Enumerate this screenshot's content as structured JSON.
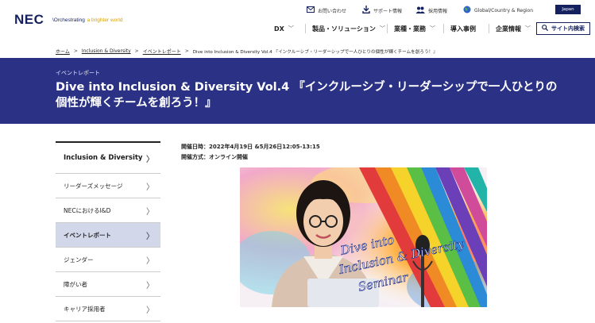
{
  "header": {
    "logo": "NEC",
    "tagline_prefix": "\\Orchestrating",
    "tagline_accent": " a brighter world",
    "utility": [
      {
        "icon": "mail-icon",
        "label": "お問い合わせ"
      },
      {
        "icon": "download-icon",
        "label": "サポート情報"
      },
      {
        "icon": "people-icon",
        "label": "採用情報"
      },
      {
        "icon": "globe-icon",
        "label": "Global/Country & Region"
      }
    ],
    "language": "Japan",
    "gnav": [
      {
        "label": "DX"
      },
      {
        "label": "製品・ソリューション"
      },
      {
        "label": "業種・業務"
      },
      {
        "label": "導入事例"
      },
      {
        "label": "企業情報"
      }
    ],
    "search_label": "サイト内検索"
  },
  "breadcrumb": [
    "ホーム",
    "Inclusion & Diversity",
    "イベントレポート",
    "Dive into Inclusion & Diversity Vol.4 『インクルーシブ・リーダーシップで一人ひとりの個性が輝くチームを創ろう！』"
  ],
  "hero": {
    "eyebrow": "イベントレポート",
    "title": "Dive into Inclusion & Diversity Vol.4 『インクルーシブ・リーダーシップで一人ひとりの個性が輝くチームを創ろう！』"
  },
  "sidebar": {
    "heading": "Inclusion & Diversity",
    "items": [
      {
        "label": "リーダーズメッセージ",
        "active": false
      },
      {
        "label": "NECにおけるI&D",
        "active": false
      },
      {
        "label": "イベントレポート",
        "active": true
      },
      {
        "label": "ジェンダー",
        "active": false
      },
      {
        "label": "障がい者",
        "active": false
      },
      {
        "label": "キャリア採用者",
        "active": false
      }
    ]
  },
  "event": {
    "date": "開催日時：2022年4月19日 &5月26日12:05-13:15",
    "format": "開催方式：オンライン開催"
  },
  "photo": {
    "overlay_line1": "Dive into",
    "overlay_line2": "Inclusion & Diversity",
    "overlay_line3": "Seminar"
  },
  "colors": {
    "brand_navy": "#14215e",
    "hero_bg": "#2b3285",
    "active_item": "#d3d7ea",
    "accent_yellow": "#d8a100"
  }
}
